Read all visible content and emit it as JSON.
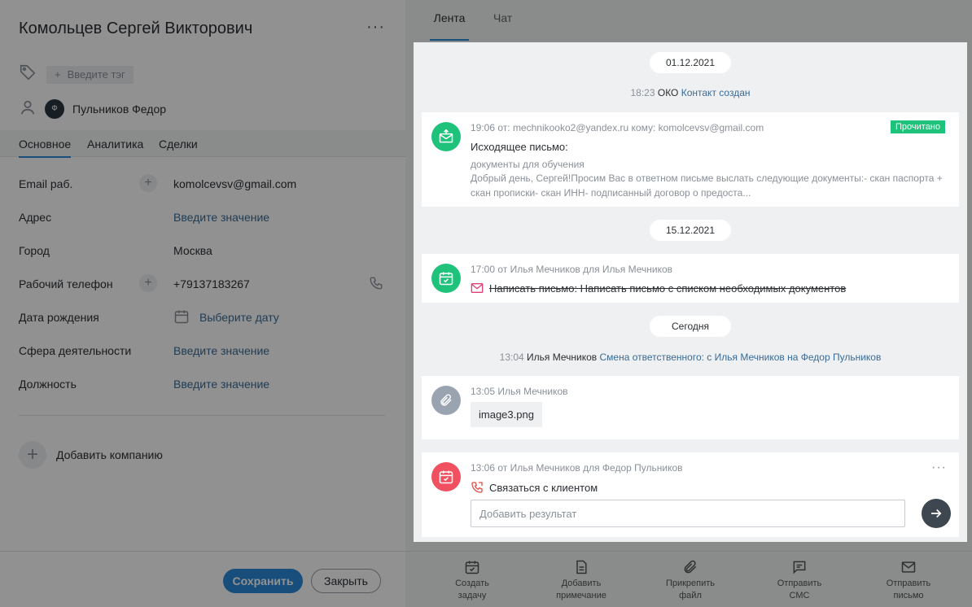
{
  "contact": {
    "name": "Комольцев Сергей Викторович",
    "more": "···",
    "tag_placeholder": "Введите тэг",
    "owner_initial": "Ф",
    "owner_name": "Пульников Федор"
  },
  "left_tabs": [
    "Основное",
    "Аналитика",
    "Сделки"
  ],
  "fields": {
    "email_label": "Email раб.",
    "email_value": "komolcevsv@gmail.com",
    "address_label": "Адрес",
    "address_placeholder": "Введите значение",
    "city_label": "Город",
    "city_value": "Москва",
    "phone_label": "Рабочий телефон",
    "phone_value": "+79137183267",
    "birth_label": "Дата рождения",
    "birth_placeholder": "Выберите дату",
    "sphere_label": "Сфера деятельности",
    "sphere_placeholder": "Введите значение",
    "position_label": "Должность",
    "position_placeholder": "Введите значение"
  },
  "add_company": "Добавить компанию",
  "left_footer": {
    "save": "Сохранить",
    "close": "Закрыть"
  },
  "right_tabs": {
    "feed": "Лента",
    "chat": "Чат"
  },
  "feed": {
    "date1": "01.12.2021",
    "sys1_time": "18:23",
    "sys1_actor": "ОКО",
    "sys1_text": "Контакт создан",
    "email_meta": "19:06 от: mechnikooko2@yandex.ru кому: komolcevsv@gmail.com",
    "email_badge": "Прочитано",
    "email_title": "Исходящее письмо:",
    "email_subject": "документы для обучения",
    "email_body": "Добрый день, Сергей!Просим Вас в ответном письме выслать следующие документы:- скан паспорта + скан прописки- скан ИНН- подписанный договор о предоста...",
    "date2": "15.12.2021",
    "task1_meta": "17:00 от Илья Мечников для Илья Мечников",
    "task1_text": "Написать письмо: Написать письмо с списком необходимых документов",
    "date3": "Сегодня",
    "sys2_time": "13:04",
    "sys2_actor": "Илья Мечников",
    "sys2_text": "Смена ответственного: с Илья Мечников на Федор Пульников",
    "file_meta": "13:05 Илья Мечников",
    "file_name": "image3.png",
    "task2_meta": "13:06 от Илья Мечников для Федор Пульников",
    "task2_text": "Связаться с клиентом",
    "task2_more": "···",
    "result_placeholder": "Добавить результат"
  },
  "right_footer": {
    "create_task": [
      "Создать",
      "задачу"
    ],
    "add_note": [
      "Добавить",
      "примечание"
    ],
    "attach_file": [
      "Прикрепить",
      "файл"
    ],
    "send_sms": [
      "Отправить",
      "СМС"
    ],
    "send_email": [
      "Отправить",
      "письмо"
    ]
  },
  "colors": {
    "accent": "#2b8ad8",
    "success": "#1ec27a",
    "danger": "#f0505f",
    "muted": "#8a9099"
  }
}
